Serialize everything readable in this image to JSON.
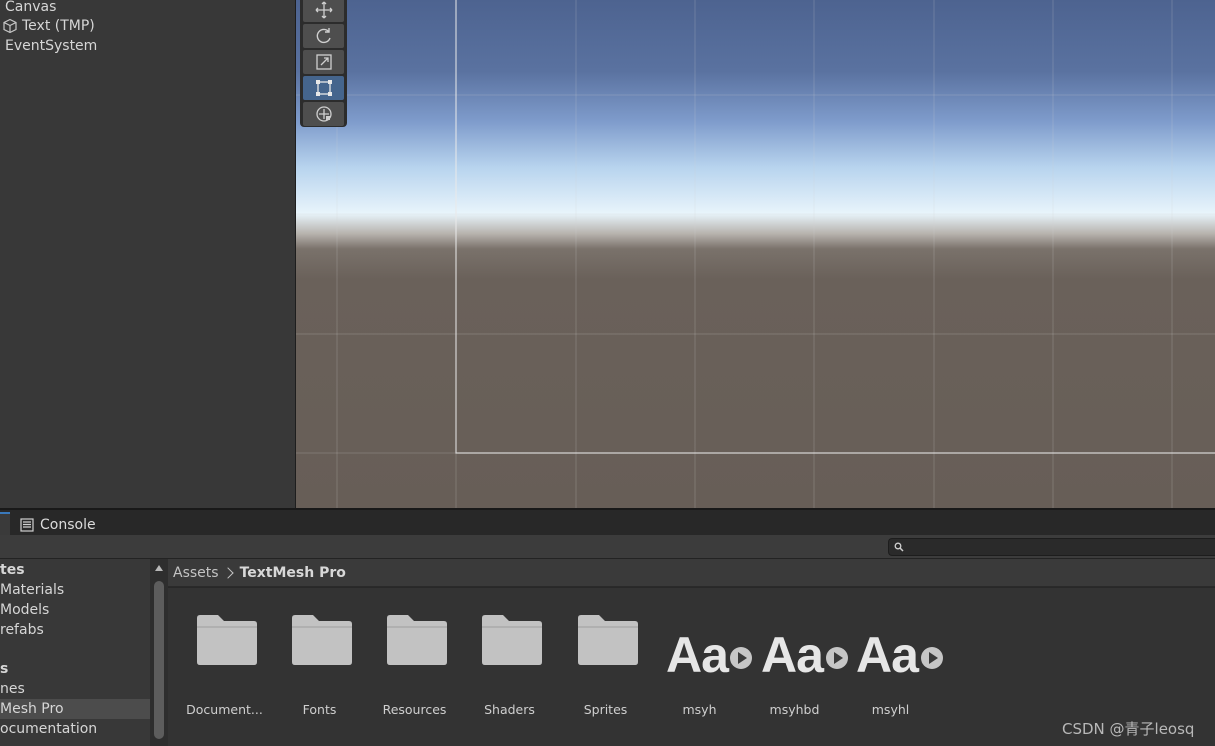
{
  "hierarchy": {
    "items": [
      {
        "label": "Canvas"
      },
      {
        "label": "Text (TMP)"
      },
      {
        "label": "EventSystem"
      }
    ]
  },
  "scene": {
    "tools": [
      {
        "name": "move-tool-icon",
        "active": false
      },
      {
        "name": "rotate-tool-icon",
        "active": false
      },
      {
        "name": "scale-tool-icon",
        "active": false
      },
      {
        "name": "rect-tool-icon",
        "active": true
      },
      {
        "name": "transform-tool-icon",
        "active": false
      }
    ],
    "sky_color": "#5a72a0",
    "ground_color": "#675e57"
  },
  "tabs": {
    "console_label": "Console"
  },
  "tree": {
    "items": [
      {
        "label": "tes",
        "bold": true
      },
      {
        "label": "Materials",
        "bold": false
      },
      {
        "label": "Models",
        "bold": false
      },
      {
        "label": "refabs",
        "bold": false
      },
      {
        "label": "s",
        "bold": true
      },
      {
        "label": "nes",
        "bold": false
      },
      {
        "label": "Mesh Pro",
        "bold": false,
        "selected": true
      },
      {
        "label": "ocumentation",
        "bold": false
      }
    ]
  },
  "breadcrumb": {
    "root": "Assets",
    "current": "TextMesh Pro"
  },
  "assets": [
    {
      "label": "Document...",
      "kind": "folder"
    },
    {
      "label": "Fonts",
      "kind": "folder"
    },
    {
      "label": "Resources",
      "kind": "folder"
    },
    {
      "label": "Shaders",
      "kind": "folder"
    },
    {
      "label": "Sprites",
      "kind": "folder"
    },
    {
      "label": "msyh",
      "kind": "font",
      "glyph": "Aa"
    },
    {
      "label": "msyhbd",
      "kind": "font",
      "glyph": "Aa"
    },
    {
      "label": "msyhl",
      "kind": "font",
      "glyph": "Aa"
    }
  ],
  "watermark": "CSDN @青子leosq"
}
